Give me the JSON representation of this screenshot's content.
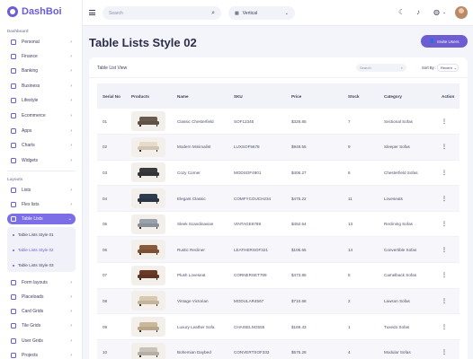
{
  "app": {
    "name": "DashBoi"
  },
  "sidebar": {
    "sections": [
      "Dashboard",
      "Layouts"
    ],
    "dashboard_items": [
      {
        "label": "Personal"
      },
      {
        "label": "Finance"
      },
      {
        "label": "Banking"
      },
      {
        "label": "Business"
      },
      {
        "label": "Lifestyle"
      },
      {
        "label": "Ecommerce"
      },
      {
        "label": "Apps"
      },
      {
        "label": "Charts"
      },
      {
        "label": "Widgets"
      }
    ],
    "layout_items": [
      {
        "label": "Lists"
      },
      {
        "label": "Flex lists"
      },
      {
        "label": "Table Lists"
      }
    ],
    "sub_items": [
      {
        "label": "Table Lists Style 01"
      },
      {
        "label": "Table Lists Style 02"
      },
      {
        "label": "Table Lists Style 03"
      }
    ],
    "more_items": [
      {
        "label": "Form layouts"
      },
      {
        "label": "Placeloads"
      },
      {
        "label": "Card Grids"
      },
      {
        "label": "Tile Grids"
      },
      {
        "label": "User Grids"
      },
      {
        "label": "Projects"
      }
    ]
  },
  "topbar": {
    "search_placeholder": "Search",
    "layout_value": "Vertical"
  },
  "page": {
    "title": "Table Lists Style 02",
    "invite_label": "Invite Users"
  },
  "card": {
    "title": "Table List View",
    "search_placeholder": "Search",
    "sort_label": "Sort By :",
    "sort_value": "Recent"
  },
  "table": {
    "headers": [
      "Serial No",
      "Products",
      "Name",
      "SKU",
      "Price",
      "Stock",
      "Category",
      "Action"
    ],
    "rows": [
      {
        "serial": "01",
        "name": "Classic Chesterfield",
        "sku": "SOF12345",
        "price": "$328.85",
        "stock": "7",
        "category": "Sectional Sofas",
        "color": "#6b5b4e"
      },
      {
        "serial": "02",
        "name": "Modern Minimalist",
        "sku": "LUXSOF5678",
        "price": "$948.55",
        "stock": "9",
        "category": "Sleeper Sofas",
        "color": "#e8dcc8"
      },
      {
        "serial": "03",
        "name": "Cozy Corner",
        "sku": "MODSOF4901",
        "price": "$406.27",
        "stock": "6",
        "category": "Chesterfield Sofas",
        "color": "#3a3a3d"
      },
      {
        "serial": "04",
        "name": "Elegant Classic",
        "sku": "COMFYCOUCH234",
        "price": "$475.22",
        "stock": "11",
        "category": "Loveseats",
        "color": "#2f3b4f"
      },
      {
        "serial": "05",
        "name": "Sleek Scandinavian",
        "sku": "VINTAGE6789",
        "price": "$452.54",
        "stock": "13",
        "category": "Reclining Sofas",
        "color": "#9aa1ab"
      },
      {
        "serial": "06",
        "name": "Rustic Recliner",
        "sku": "LEATHERSOF321",
        "price": "$105.65",
        "stock": "14",
        "category": "Convertible Sofas",
        "color": "#8a5a3c"
      },
      {
        "serial": "07",
        "name": "Plush Loveseat",
        "sku": "CORNERSET789",
        "price": "$473.85",
        "stock": "5",
        "category": "Camelback Sofas",
        "color": "#6a3a26"
      },
      {
        "serial": "08",
        "name": "Vintage Victorian",
        "sku": "MODULAR4567",
        "price": "$710.68",
        "stock": "2",
        "category": "Lawson Sofas",
        "color": "#d8c8ae"
      },
      {
        "serial": "09",
        "name": "Luxury Leather Sofa",
        "sku": "CHAISELNG555",
        "price": "$169.43",
        "stock": "1",
        "category": "Tuxedo Sofas",
        "color": "#cbb89a"
      },
      {
        "serial": "10",
        "name": "Bohemian Daybed",
        "sku": "CONVERTSOF333",
        "price": "$575.28",
        "stock": "4",
        "category": "Modular Sofas",
        "color": "#c9c2b8"
      }
    ]
  },
  "colors": {
    "accent": "#6c5dd3",
    "active_menu": "#7c6ee6",
    "background": "#f4f5fb"
  }
}
